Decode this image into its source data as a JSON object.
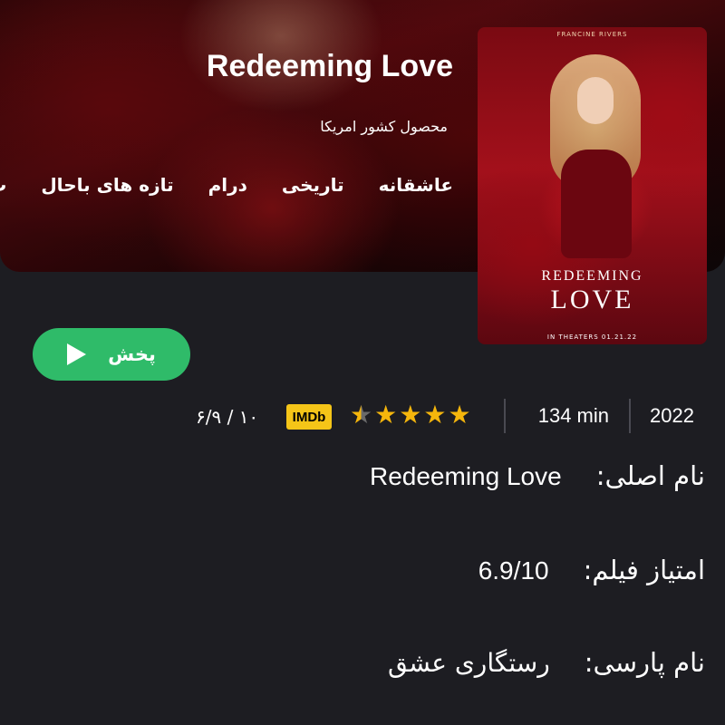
{
  "hero": {
    "title": "Redeeming Love",
    "country_line": "محصول کشور امریکا",
    "genres": [
      "عاشقانه",
      "تاریخی",
      "درام",
      "تازه های باحال",
      "پ"
    ]
  },
  "poster": {
    "credit": "FRANCINE RIVERS",
    "title_line1": "REDEEMING",
    "title_line2": "LOVE",
    "release": "IN THEATERS 01.21.22"
  },
  "play_button": {
    "label": "پخش",
    "icon": "play-icon",
    "color": "#2fbb69"
  },
  "info": {
    "year": "2022",
    "runtime": "134 min",
    "rating_stars": 4.5,
    "rating_stars_max": 5,
    "imdb_badge": "IMDb",
    "imdb_score": "۱۰ / ۶/۹"
  },
  "details": {
    "original_name_label": "نام اصلی:",
    "original_name_value": "Redeeming Love",
    "rating_label": "امتیاز فیلم:",
    "rating_value": "6.9/10",
    "persian_name_label": "نام پارسی:",
    "persian_name_value": "رستگاری عشق"
  },
  "colors": {
    "background": "#1d1d22",
    "accent_green": "#2fbb69",
    "star": "#f5b60c",
    "imdb": "#f5c518"
  }
}
